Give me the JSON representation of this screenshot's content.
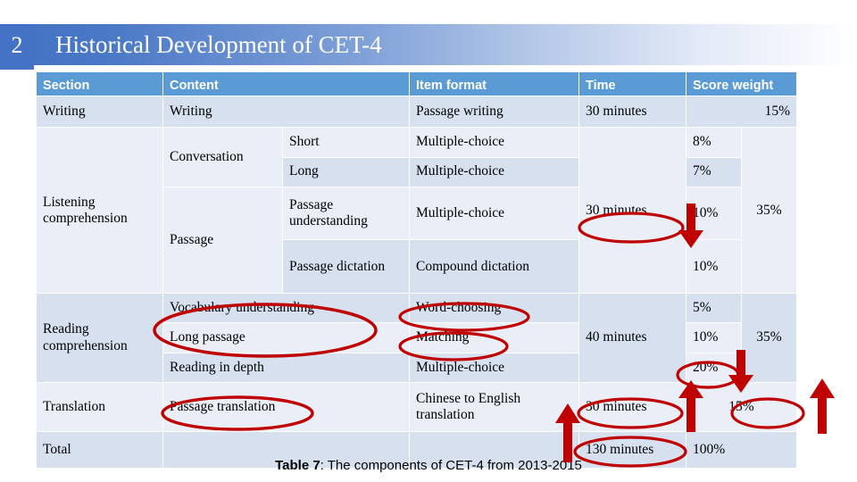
{
  "slide": {
    "number": "2",
    "title": "Historical Development of CET-4"
  },
  "table": {
    "headers": [
      "Section",
      "Content",
      "Item format",
      "Time",
      "Score weight"
    ],
    "rows": [
      {
        "section": "Writing",
        "content": "Writing",
        "subcontent": "",
        "item_format": "Passage writing",
        "time": "30 minutes",
        "weight": "15%",
        "weight_group": ""
      },
      {
        "section": "Listening comprehension",
        "content": "Conversation",
        "subcontent": "Short",
        "item_format": "Multiple-choice",
        "time": "30 minutes",
        "weight": "8%",
        "weight_group": "35%"
      },
      {
        "section": "",
        "content": "Conversation",
        "subcontent": "Long",
        "item_format": "Multiple-choice",
        "time": "",
        "weight": "7%",
        "weight_group": ""
      },
      {
        "section": "",
        "content": "Passage",
        "subcontent": "Passage understanding",
        "item_format": "Multiple-choice",
        "time": "",
        "weight": "10%",
        "weight_group": ""
      },
      {
        "section": "",
        "content": "Passage",
        "subcontent": "Passage dictation",
        "item_format": "Compound dictation",
        "time": "",
        "weight": "10%",
        "weight_group": ""
      },
      {
        "section": "Reading comprehension",
        "content": "Vocabulary understanding",
        "subcontent": "",
        "item_format": "Word-choosing",
        "time": "40 minutes",
        "weight": "5%",
        "weight_group": "35%"
      },
      {
        "section": "",
        "content": "Long passage",
        "subcontent": "",
        "item_format": "Matching",
        "time": "",
        "weight": "10%",
        "weight_group": ""
      },
      {
        "section": "",
        "content": "Reading in depth",
        "subcontent": "",
        "item_format": "Multiple-choice",
        "time": "",
        "weight": "20%",
        "weight_group": ""
      },
      {
        "section": "Translation",
        "content": "Passage translation",
        "subcontent": "",
        "item_format": "Chinese to English translation",
        "time": "30 minutes",
        "weight": "15%",
        "weight_group": ""
      },
      {
        "section": "Total",
        "content": "",
        "subcontent": "",
        "item_format": "",
        "time": "130 minutes",
        "weight": "100%",
        "weight_group": ""
      }
    ]
  },
  "caption": {
    "label": "Table 7",
    "text": ": The components of CET-4 from 2013-2015"
  },
  "annotations": {
    "color": "#c00000",
    "ellipses": [
      "listening-time-30-minutes",
      "reading-content-vocabulary-long-passage",
      "reading-item-word-choosing",
      "reading-item-matching",
      "reading-weight-20-percent",
      "translation-content-passage-translation",
      "translation-time-30-minutes",
      "translation-weight-15-percent",
      "total-time-130-minutes"
    ],
    "arrows": [
      "arrow-down-listening-weight",
      "arrow-down-reading-group-weight",
      "arrow-up-total-time",
      "arrow-up-reading-weight",
      "arrow-up-translation-weight"
    ]
  }
}
